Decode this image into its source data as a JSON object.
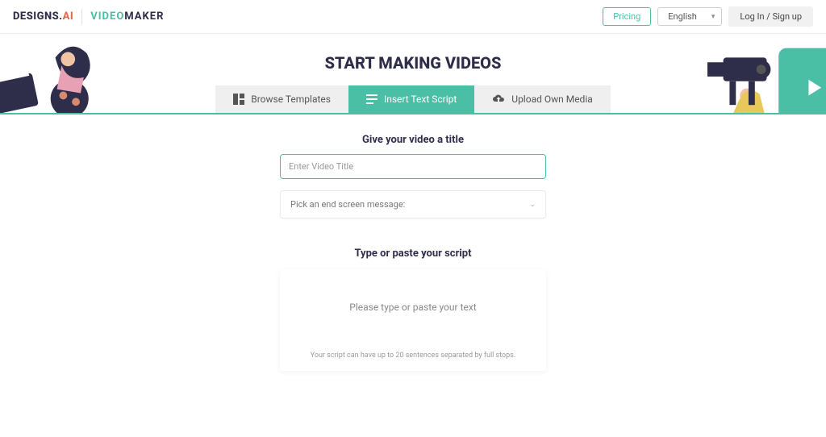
{
  "header": {
    "logo_main": "DESIGNS.",
    "logo_ai": "AI",
    "product_video": "VIDEO",
    "product_maker": "MAKER",
    "pricing": "Pricing",
    "language": "English",
    "login": "Log In / Sign up"
  },
  "hero": {
    "title": "START MAKING VIDEOS",
    "tabs": {
      "browse": "Browse Templates",
      "insert": "Insert Text Script",
      "upload": "Upload Own Media"
    }
  },
  "form": {
    "title_label": "Give your video a title",
    "title_placeholder": "Enter Video Title",
    "endscreen_placeholder": "Pick an end screen message:",
    "script_label": "Type or paste your script",
    "script_placeholder": "Please type or paste your text",
    "script_hint": "Your script can have up to 20 sentences separated by full stops."
  }
}
